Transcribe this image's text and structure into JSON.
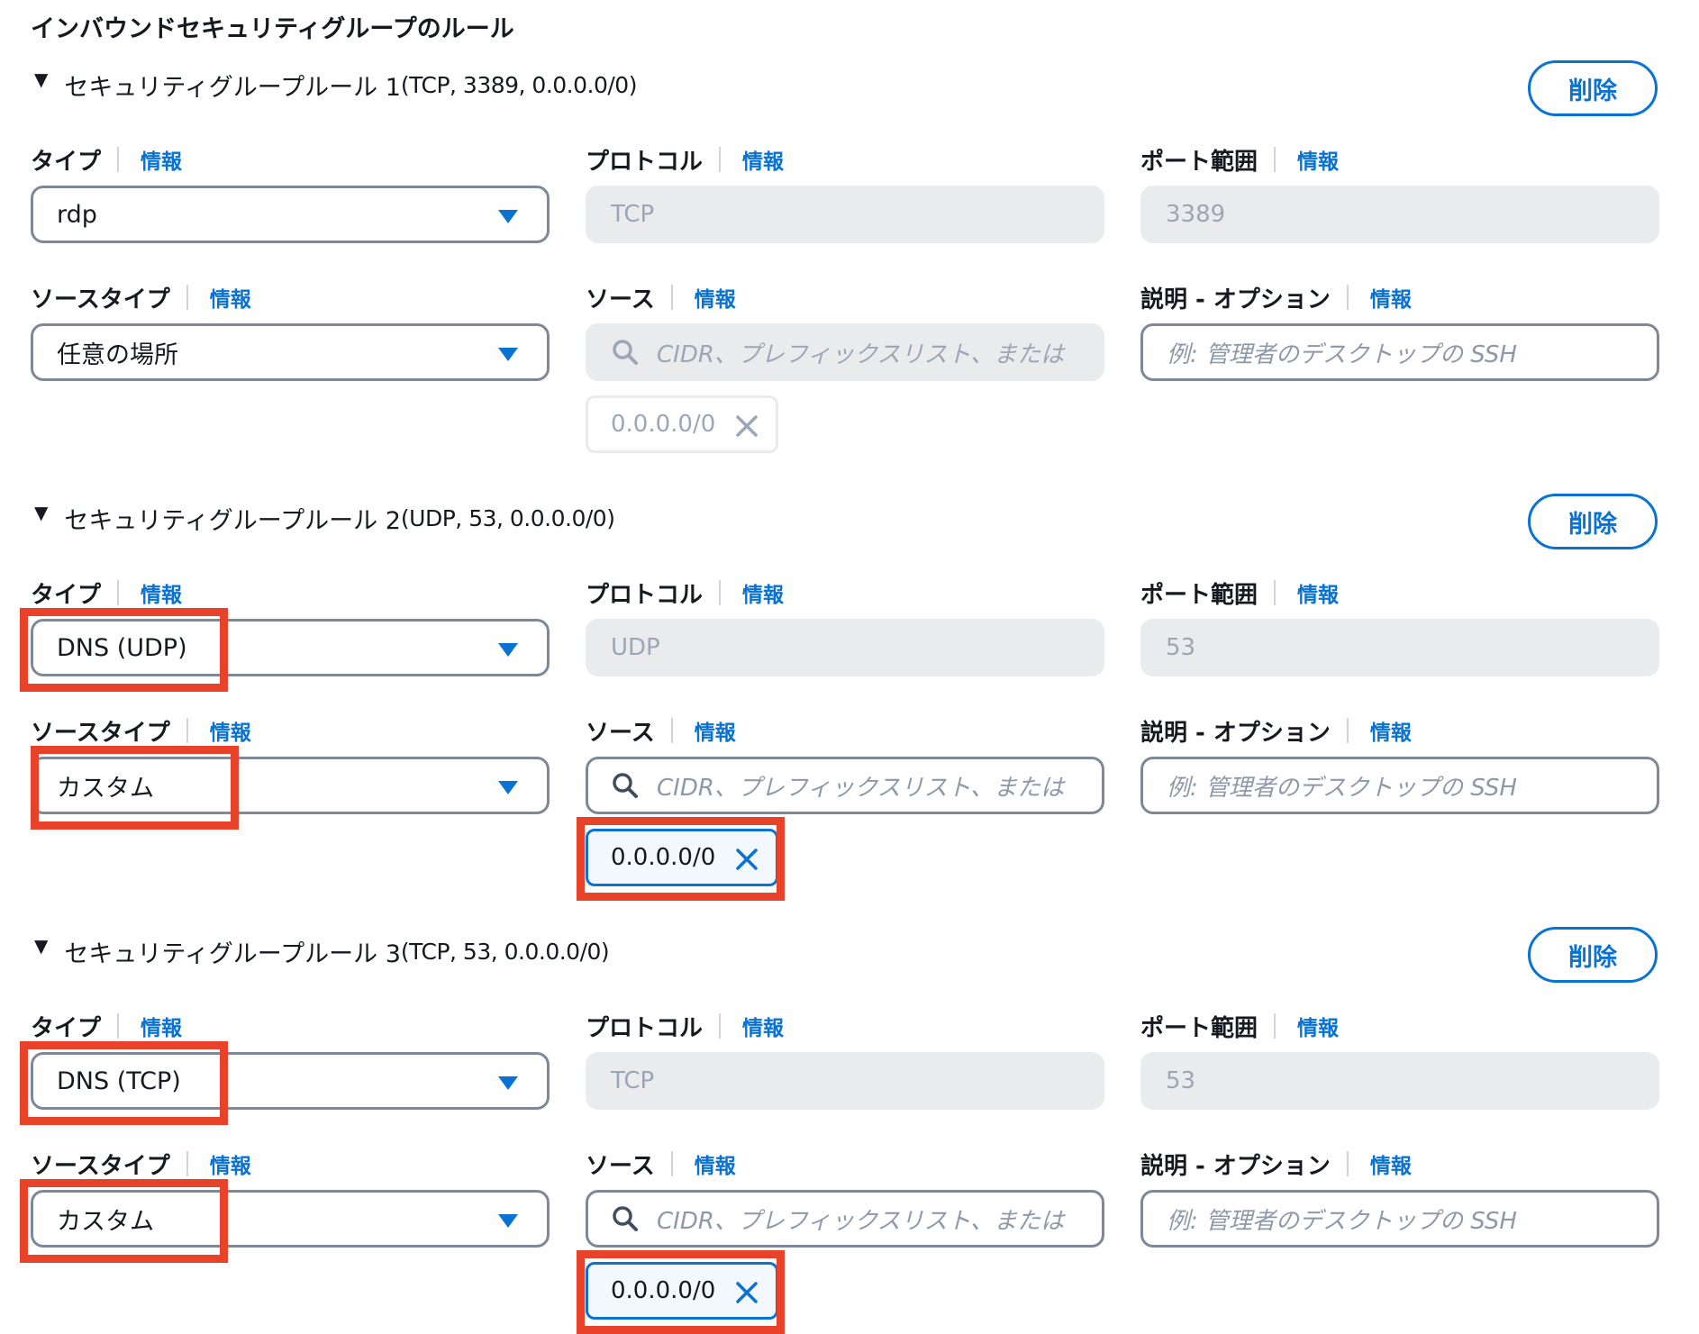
{
  "section_title": "インバウンドセキュリティグループのルール",
  "labels": {
    "type": "タイプ",
    "protocol": "プロトコル",
    "port_range": "ポート範囲",
    "source_type": "ソースタイプ",
    "source": "ソース",
    "description": "説明 - オプション",
    "info": "情報"
  },
  "delete_label": "削除",
  "source_placeholder": "CIDR、プレフィックスリスト、または",
  "description_placeholder": "例: 管理者のデスクトップの SSH",
  "colors": {
    "accent": "#0972d3",
    "highlight": "#e8422a",
    "disabled_bg": "#e9ebed"
  },
  "icons": {
    "expand": "caret-down-icon",
    "dropdown": "dropdown-arrow-icon",
    "search": "search-icon",
    "remove": "close-icon"
  },
  "rules": [
    {
      "header_main": "セキュリティグループルール 1",
      "header_sub": "(TCP, 3389, 0.0.0.0/0)",
      "type": "rdp",
      "protocol": "TCP",
      "port_range": "3389",
      "source_type": "任意の場所",
      "source_token": "0.0.0.0/0"
    },
    {
      "header_main": "セキュリティグループルール 2",
      "header_sub": "(UDP, 53, 0.0.0.0/0)",
      "type": "DNS (UDP)",
      "protocol": "UDP",
      "port_range": "53",
      "source_type": "カスタム",
      "source_token": "0.0.0.0/0"
    },
    {
      "header_main": "セキュリティグループルール 3",
      "header_sub": "(TCP, 53, 0.0.0.0/0)",
      "type": "DNS (TCP)",
      "protocol": "TCP",
      "port_range": "53",
      "source_type": "カスタム",
      "source_token": "0.0.0.0/0"
    }
  ]
}
